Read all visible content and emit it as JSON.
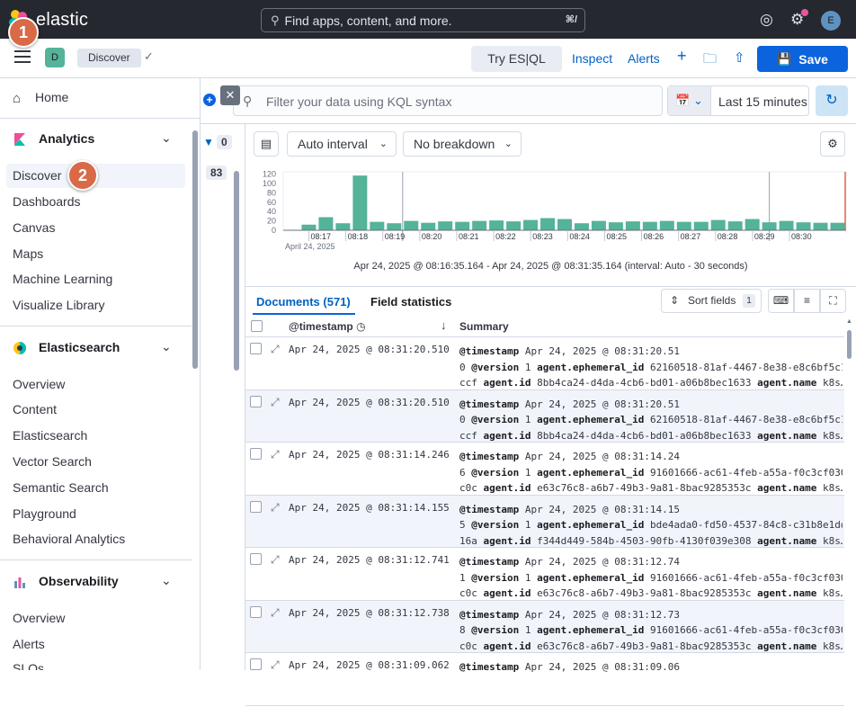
{
  "topbar": {
    "logo_text": "elastic",
    "search_placeholder": "Find apps, content, and more.",
    "search_shortcut": "⌘/",
    "avatar_letter": "E"
  },
  "header": {
    "space_letter": "D",
    "breadcrumb": "Discover",
    "try_esql": "Try ES|QL",
    "inspect": "Inspect",
    "alerts": "Alerts",
    "save": "Save"
  },
  "steps": {
    "one": "1",
    "two": "2"
  },
  "nav": {
    "home": "Home",
    "sections": [
      {
        "title": "Analytics",
        "items": [
          "Discover",
          "Dashboards",
          "Canvas",
          "Maps",
          "Machine Learning",
          "Visualize Library"
        ]
      },
      {
        "title": "Elasticsearch",
        "items": [
          "Overview",
          "Content",
          "Elasticsearch",
          "Vector Search",
          "Semantic Search",
          "Playground",
          "Behavioral Analytics"
        ]
      },
      {
        "title": "Observability",
        "items": [
          "Overview",
          "Alerts",
          "SLOs"
        ]
      }
    ]
  },
  "query": {
    "kql_placeholder": "Filter your data using KQL syntax",
    "time_range": "Last 15 minutes"
  },
  "sidebar": {
    "filter_count": "0",
    "field_count": "83"
  },
  "histogram_toolbar": {
    "interval": "Auto interval",
    "breakdown": "No breakdown"
  },
  "chart_data": {
    "type": "bar",
    "y_ticks": [
      "120",
      "100",
      "80",
      "60",
      "40",
      "20",
      "0"
    ],
    "ylim": [
      0,
      125
    ],
    "x_tick_labels": [
      "08:17",
      "08:18",
      "08:19",
      "08:20",
      "08:21",
      "08:22",
      "08:23",
      "08:24",
      "08:25",
      "08:26",
      "08:27",
      "08:28",
      "08:29",
      "08:30"
    ],
    "x_sub_label": "April 24, 2025",
    "values": [
      0,
      12,
      28,
      15,
      117,
      18,
      15,
      20,
      16,
      19,
      18,
      20,
      21,
      19,
      22,
      26,
      24,
      15,
      20,
      17,
      19,
      18,
      20,
      18,
      18,
      22,
      19,
      24,
      17,
      20,
      17,
      16,
      16
    ],
    "color": "#54b399",
    "interval_text": "Apr 24, 2025 @ 08:16:35.164 - Apr 24, 2025 @ 08:31:35.164 (interval: Auto - 30 seconds)"
  },
  "tabs": {
    "documents": "Documents (571)",
    "field_stats": "Field statistics"
  },
  "grid": {
    "sort_fields": "Sort fields",
    "sort_count": "1",
    "col_timestamp": "@timestamp",
    "col_summary": "Summary",
    "rows": [
      {
        "ts": "Apr 24, 2025 @ 08:31:20.510",
        "l1v": "Apr 24, 2025 @ 08:31:20.51",
        "l2a": "0",
        "l2v": "1",
        "eph": "62160518-81af-4467-8e38-e8c6bf5c1",
        "l3a": "ccf",
        "aid": "8bb4ca24-d4da-4cb6-bd01-a06b8bec1633",
        "an": "k8s…"
      },
      {
        "ts": "Apr 24, 2025 @ 08:31:20.510",
        "l1v": "Apr 24, 2025 @ 08:31:20.51",
        "l2a": "0",
        "l2v": "1",
        "eph": "62160518-81af-4467-8e38-e8c6bf5c1",
        "l3a": "ccf",
        "aid": "8bb4ca24-d4da-4cb6-bd01-a06b8bec1633",
        "an": "k8s…"
      },
      {
        "ts": "Apr 24, 2025 @ 08:31:14.246",
        "l1v": "Apr 24, 2025 @ 08:31:14.24",
        "l2a": "6",
        "l2v": "1",
        "eph": "91601666-ac61-4feb-a55a-f0c3cf030",
        "l3a": "c0c",
        "aid": "e63c76c8-a6b7-49b3-9a81-8bac9285353c",
        "an": "k8s…"
      },
      {
        "ts": "Apr 24, 2025 @ 08:31:14.155",
        "l1v": "Apr 24, 2025 @ 08:31:14.15",
        "l2a": "5",
        "l2v": "1",
        "eph": "bde4ada0-fd50-4537-84c8-c31b8e1dd",
        "l3a": "16a",
        "aid": "f344d449-584b-4503-90fb-4130f039e308",
        "an": "k8s…"
      },
      {
        "ts": "Apr 24, 2025 @ 08:31:12.741",
        "l1v": "Apr 24, 2025 @ 08:31:12.74",
        "l2a": "1",
        "l2v": "1",
        "eph": "91601666-ac61-4feb-a55a-f0c3cf030",
        "l3a": "c0c",
        "aid": "e63c76c8-a6b7-49b3-9a81-8bac9285353c",
        "an": "k8s…"
      },
      {
        "ts": "Apr 24, 2025 @ 08:31:12.738",
        "l1v": "Apr 24, 2025 @ 08:31:12.73",
        "l2a": "8",
        "l2v": "1",
        "eph": "91601666-ac61-4feb-a55a-f0c3cf030",
        "l3a": "c0c",
        "aid": "e63c76c8-a6b7-49b3-9a81-8bac9285353c",
        "an": "k8s…"
      },
      {
        "ts": "Apr 24, 2025 @ 08:31:09.062",
        "l1v": "Apr 24, 2025 @ 08:31:09.06",
        "l2a": "",
        "l2v": "",
        "eph": "",
        "l3a": "",
        "aid": "",
        "an": ""
      }
    ],
    "key_timestamp": "@timestamp",
    "key_version": "@version",
    "key_eph": "agent.ephemeral_id",
    "key_agent_id": "agent.id",
    "key_agent_name": "agent.name"
  }
}
